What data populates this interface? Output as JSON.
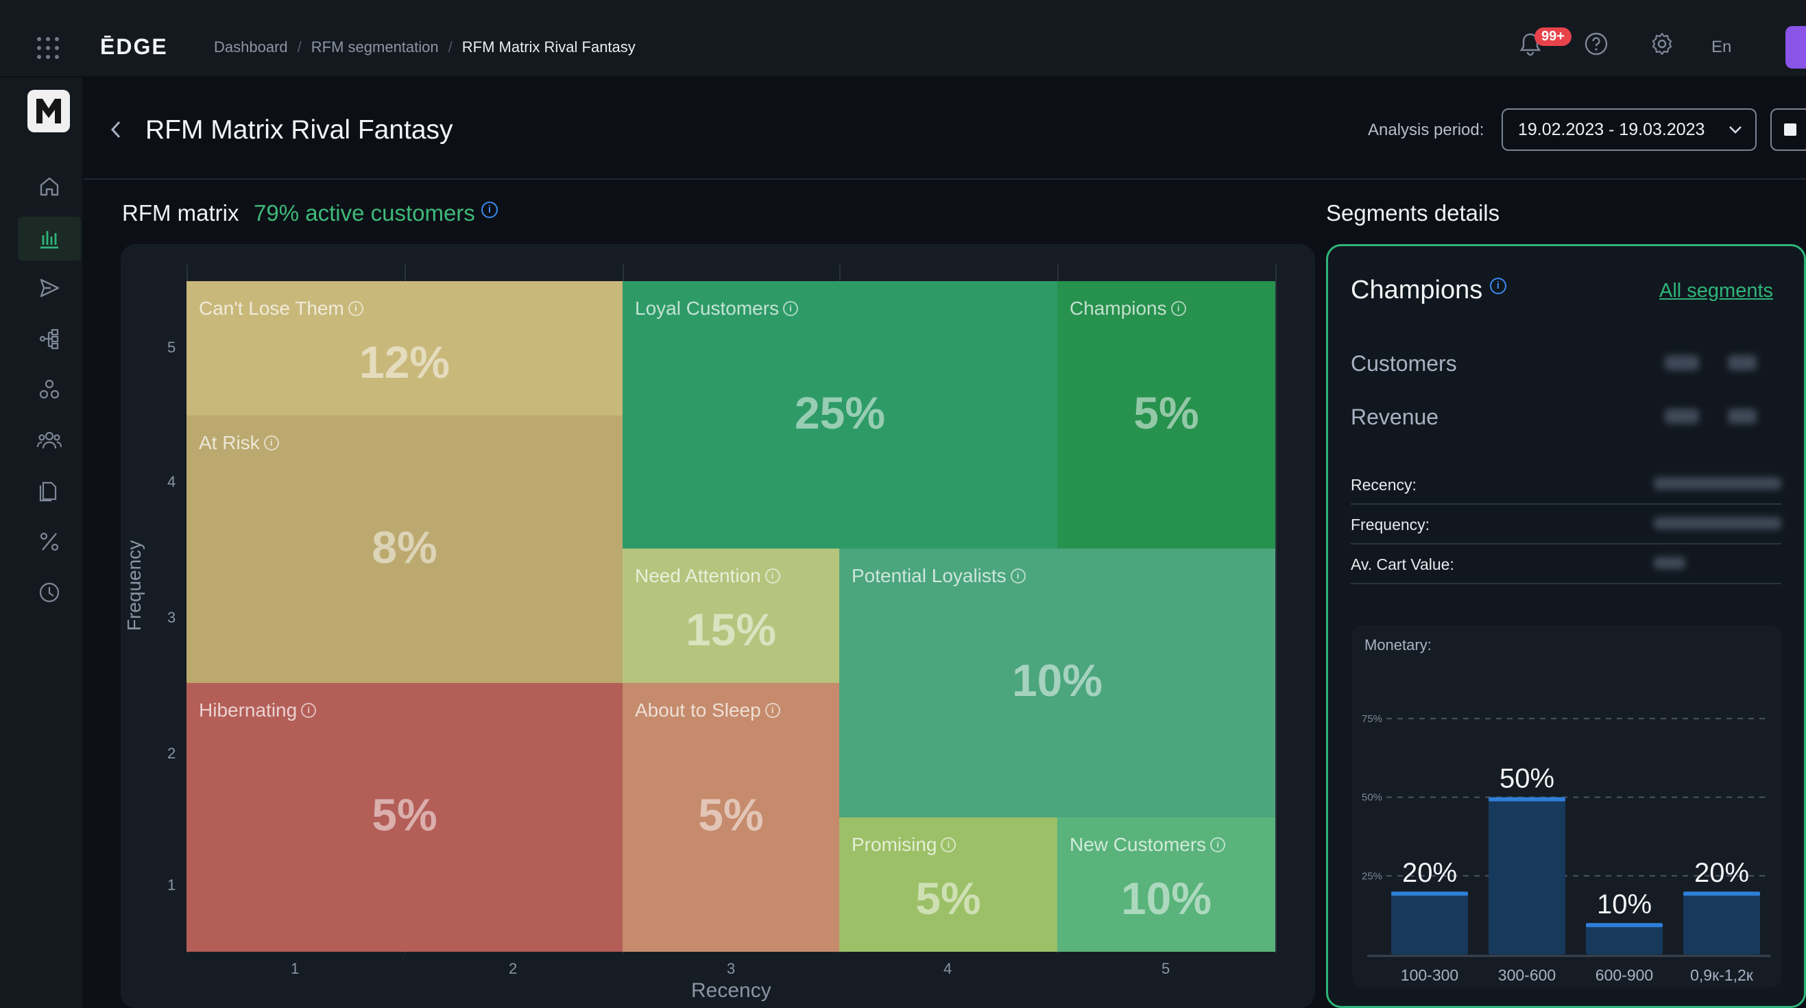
{
  "header": {
    "logo": "ĒDGE",
    "breadcrumbs": [
      "Dashboard",
      "RFM segmentation",
      "RFM Matrix Rival Fantasy"
    ],
    "notification_badge": "99+",
    "language": "En"
  },
  "page": {
    "title": "RFM Matrix Rival Fantasy",
    "analysis_period_label": "Analysis period:",
    "analysis_period_value": "19.02.2023 - 19.03.2023"
  },
  "matrix": {
    "title": "RFM matrix",
    "subtitle": "79% active customers",
    "y_label": "Frequency",
    "x_label": "Recency",
    "y_ticks": [
      "5",
      "4",
      "3",
      "2",
      "1"
    ],
    "x_ticks": [
      "1",
      "2",
      "3",
      "4",
      "5"
    ],
    "cells": [
      {
        "name": "Can't Lose Them",
        "pct": "12%",
        "color": "#c8b87a"
      },
      {
        "name": "Loyal Customers",
        "pct": "25%",
        "color": "#2e9b67"
      },
      {
        "name": "Champions",
        "pct": "5%",
        "color": "#27914e"
      },
      {
        "name": "At Risk",
        "pct": "8%",
        "color": "#bba96f"
      },
      {
        "name": "Need Attention",
        "pct": "15%",
        "color": "#b6c47e"
      },
      {
        "name": "Potential Loyalists",
        "pct": "10%",
        "color": "#4ba57d"
      },
      {
        "name": "Hibernating",
        "pct": "5%",
        "color": "#b45e58"
      },
      {
        "name": "About to Sleep",
        "pct": "5%",
        "color": "#c58b6c"
      },
      {
        "name": "Promising",
        "pct": "5%",
        "color": "#9cc067"
      },
      {
        "name": "New Customers",
        "pct": "10%",
        "color": "#59b37b"
      }
    ]
  },
  "segment": {
    "section_title": "Segments details",
    "name": "Champions",
    "all_segments_link": "All segments",
    "customers_label": "Customers",
    "revenue_label": "Revenue",
    "recency_label": "Recency:",
    "frequency_label": "Frequency:",
    "cart_label": "Av. Cart Value:",
    "monetary_title": "Monetary:"
  },
  "chart_data": {
    "type": "bar",
    "title": "Monetary:",
    "categories": [
      "100-300",
      "300-600",
      "600-900",
      "0,9к-1,2к"
    ],
    "values": [
      20,
      50,
      10,
      20
    ],
    "value_labels": [
      "20%",
      "50%",
      "10%",
      "20%"
    ],
    "gridlines": [
      25,
      50,
      75
    ],
    "gridline_labels": [
      "25%",
      "50%",
      "75%"
    ],
    "ylim": [
      0,
      85
    ],
    "bar_color": "#17395c",
    "bar_top_color": "#2f7fd8"
  }
}
